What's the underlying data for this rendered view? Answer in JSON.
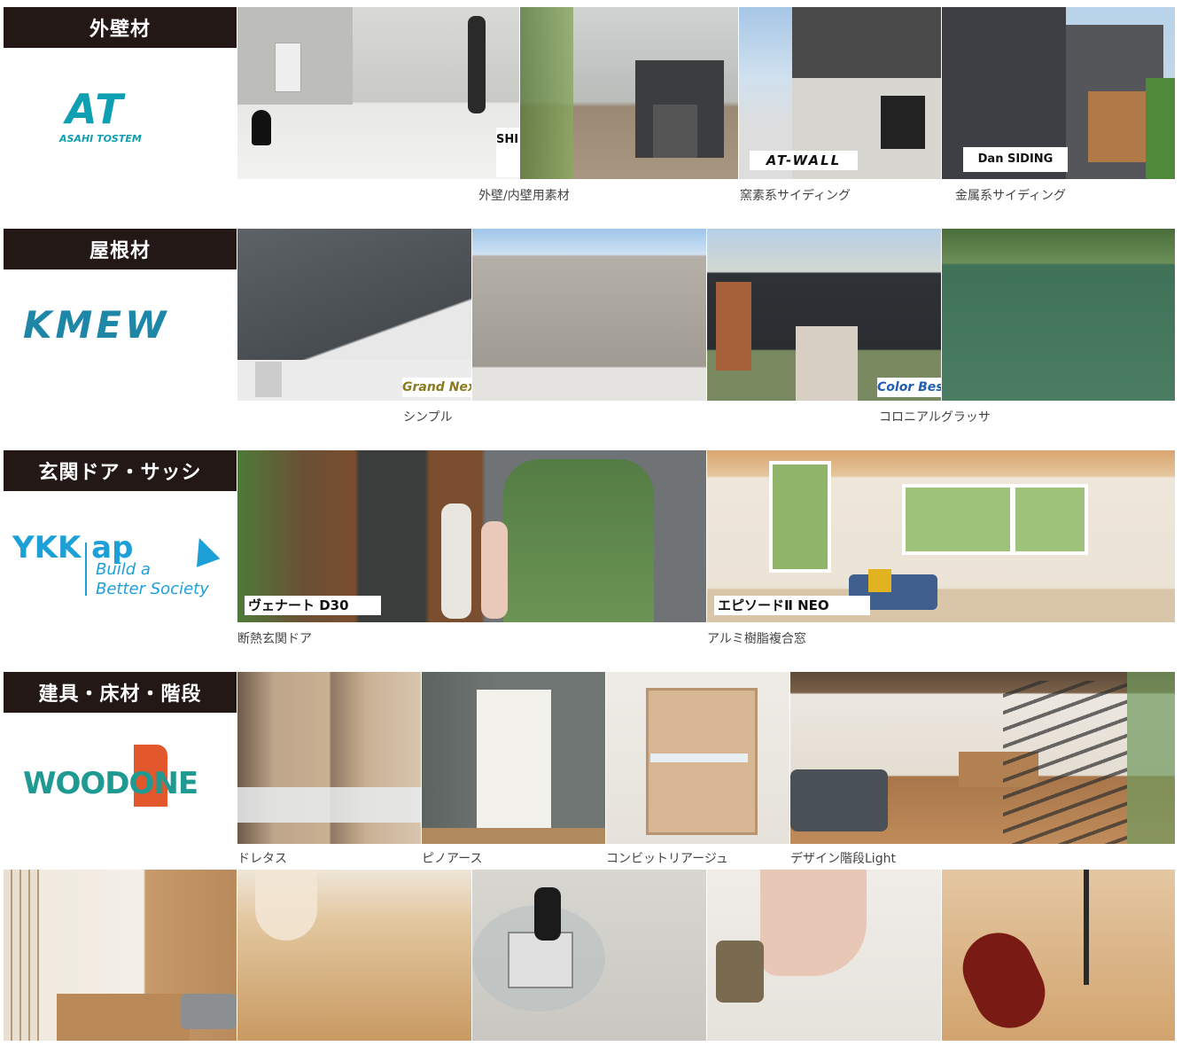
{
  "sections": [
    {
      "category": "外壁材",
      "brand": "AT",
      "brand_sub": "ASAHI TOSTEM",
      "captions": [
        "外壁/内壁用素材",
        "窯素系サイディング",
        "金属系サイディング"
      ],
      "badges": [
        "SHI ZEN",
        "AT-WALL",
        "Dan SIDING"
      ]
    },
    {
      "category": "屋根材",
      "brand": "KMEW",
      "captions": [
        "シンプル",
        "コロニアルグラッサ"
      ],
      "badges": [
        "Grand Next",
        "Color Best"
      ]
    },
    {
      "category": "玄関ドア・サッシ",
      "brand": "YKK ap",
      "brand_slogan_1": "Build a",
      "brand_slogan_2": "Better Society",
      "captions": [
        "断熱玄関ドア",
        "アルミ樹脂複合窓"
      ],
      "badges": [
        "ヴェナート D30",
        "エピソードⅡ NEO"
      ]
    },
    {
      "category": "建具・床材・階段",
      "brand": "WOODONE",
      "captions": [
        "ドレタス",
        "ピノアース",
        "コンビットリアージュ",
        "デザイン階段Light"
      ]
    }
  ],
  "colors": {
    "label_bg": "#231815",
    "at_brand": "#0e9fb3",
    "kmew_brand": "#1e87a8",
    "ykk_brand": "#1da0d8",
    "woodone_green": "#1f9a92",
    "woodone_orange": "#e2572b"
  }
}
